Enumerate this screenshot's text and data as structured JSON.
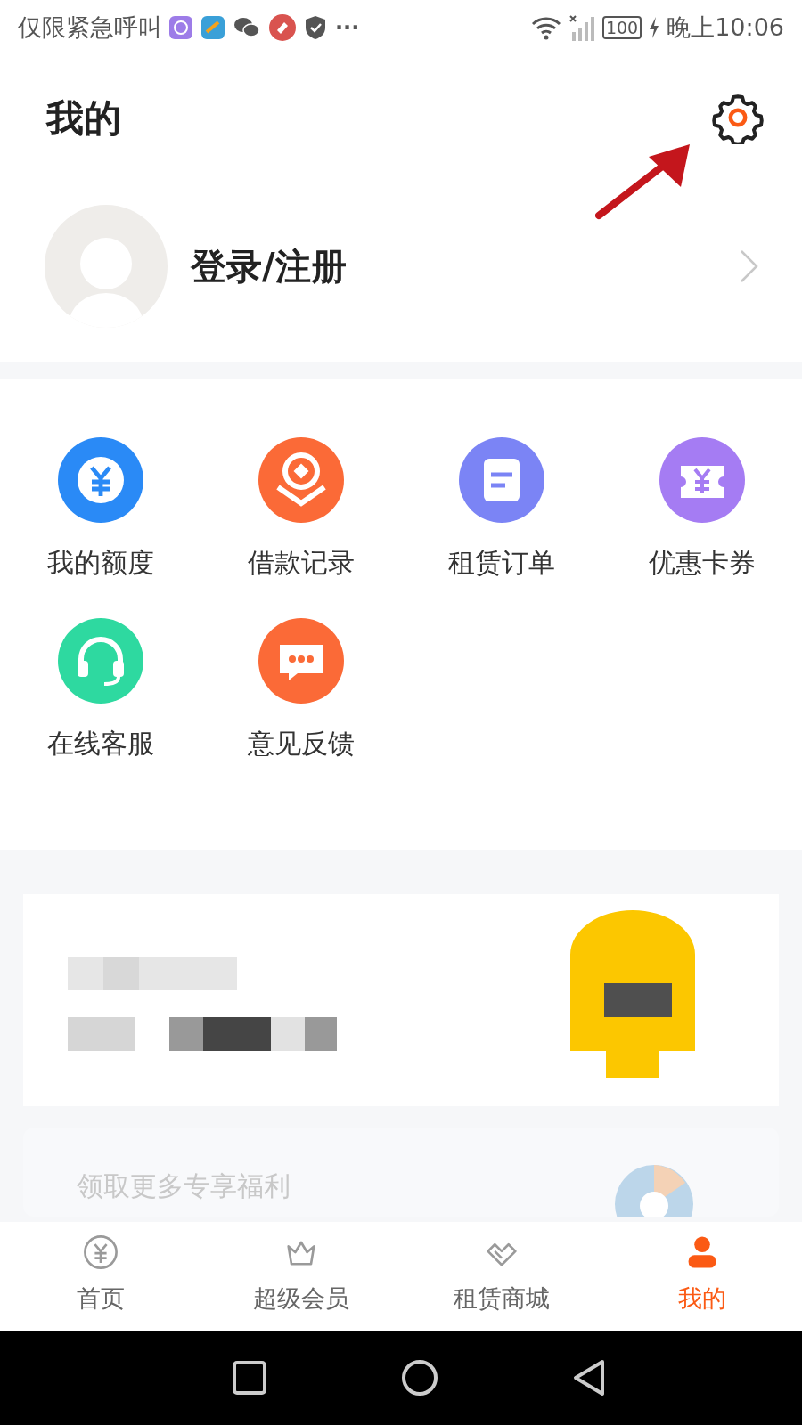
{
  "status_bar": {
    "carrier": "仅限紧急呼叫",
    "more": "···",
    "battery": "100",
    "time": "晚上10:06"
  },
  "header": {
    "title": "我的"
  },
  "profile": {
    "login": "登录/注册"
  },
  "menu": [
    {
      "label": "我的额度",
      "kind": "yuan",
      "color": "#2a8af6"
    },
    {
      "label": "借款记录",
      "kind": "loan",
      "color": "#fb6a37"
    },
    {
      "label": "租赁订单",
      "kind": "order",
      "color": "#7b84f5"
    },
    {
      "label": "优惠卡券",
      "kind": "coupon",
      "color": "#a57cf3"
    },
    {
      "label": "在线客服",
      "kind": "headset",
      "color": "#2ed9a0"
    },
    {
      "label": "意见反馈",
      "kind": "chat",
      "color": "#fb6a37"
    }
  ],
  "promo": {
    "text": "领取更多专享福利"
  },
  "tab_bar": [
    {
      "label": "首页",
      "kind": "yuan",
      "selected": false
    },
    {
      "label": "超级会员",
      "kind": "crown",
      "selected": false
    },
    {
      "label": "租赁商城",
      "kind": "heart",
      "selected": false
    },
    {
      "label": "我的",
      "kind": "person",
      "selected": true
    }
  ]
}
